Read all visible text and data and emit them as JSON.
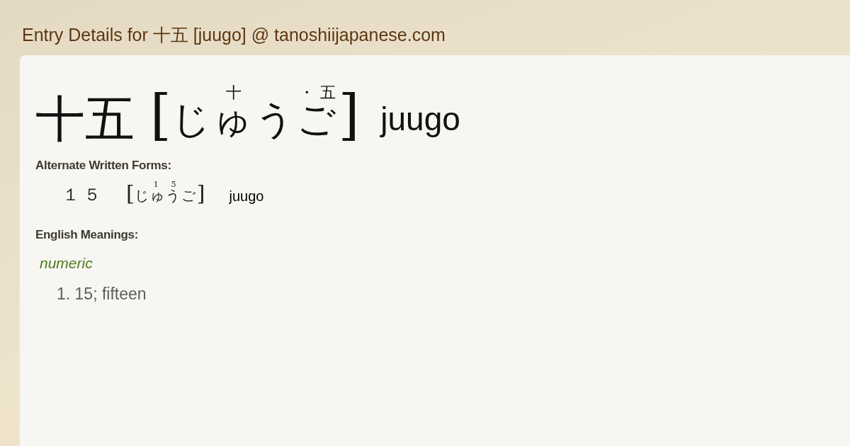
{
  "page_title": "Entry Details for 十五 [juugo] @ tanoshiijapanese.com",
  "entry": {
    "word": "十五",
    "open_bracket": "[",
    "reading": [
      {
        "kana": "じゅう",
        "ruby": "十"
      },
      {
        "kana": "ご",
        "ruby": "・五"
      }
    ],
    "close_bracket": "]",
    "romaji": "juugo"
  },
  "alternate": {
    "heading": "Alternate Written Forms:",
    "forms": [
      {
        "word": "１５",
        "open_bracket": "[",
        "reading": [
          {
            "kana": "じ"
          },
          {
            "kana": "ゅう",
            "ruby": "1 5"
          },
          {
            "kana": "ご"
          }
        ],
        "close_bracket": "]",
        "romaji": "juugo"
      }
    ]
  },
  "meanings": {
    "heading": "English Meanings:",
    "groups": [
      {
        "part_of_speech": "numeric",
        "senses": [
          "1. 15; fifteen"
        ]
      }
    ]
  }
}
